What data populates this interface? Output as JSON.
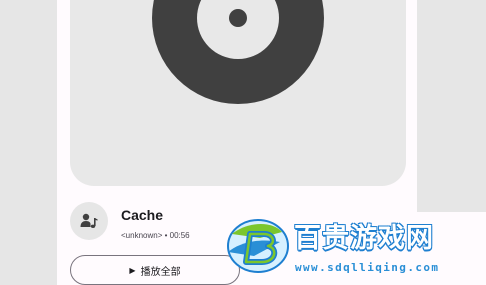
{
  "track": {
    "title": "Cache",
    "meta": "<unknown> • 00:56"
  },
  "actions": {
    "play_all_label": "播放全部",
    "play_icon": "▶"
  },
  "icons": {
    "album": "disc-icon",
    "artist": "artist-music-icon"
  },
  "watermark": {
    "name": "百贵游戏网",
    "url": "www.sdqlliqing.com"
  },
  "colors": {
    "surface": "#fffbfe",
    "disc": "#404040",
    "outline": "#79747e",
    "watermark_blue": "#1e7fd0",
    "watermark_green": "#7bc62d"
  }
}
